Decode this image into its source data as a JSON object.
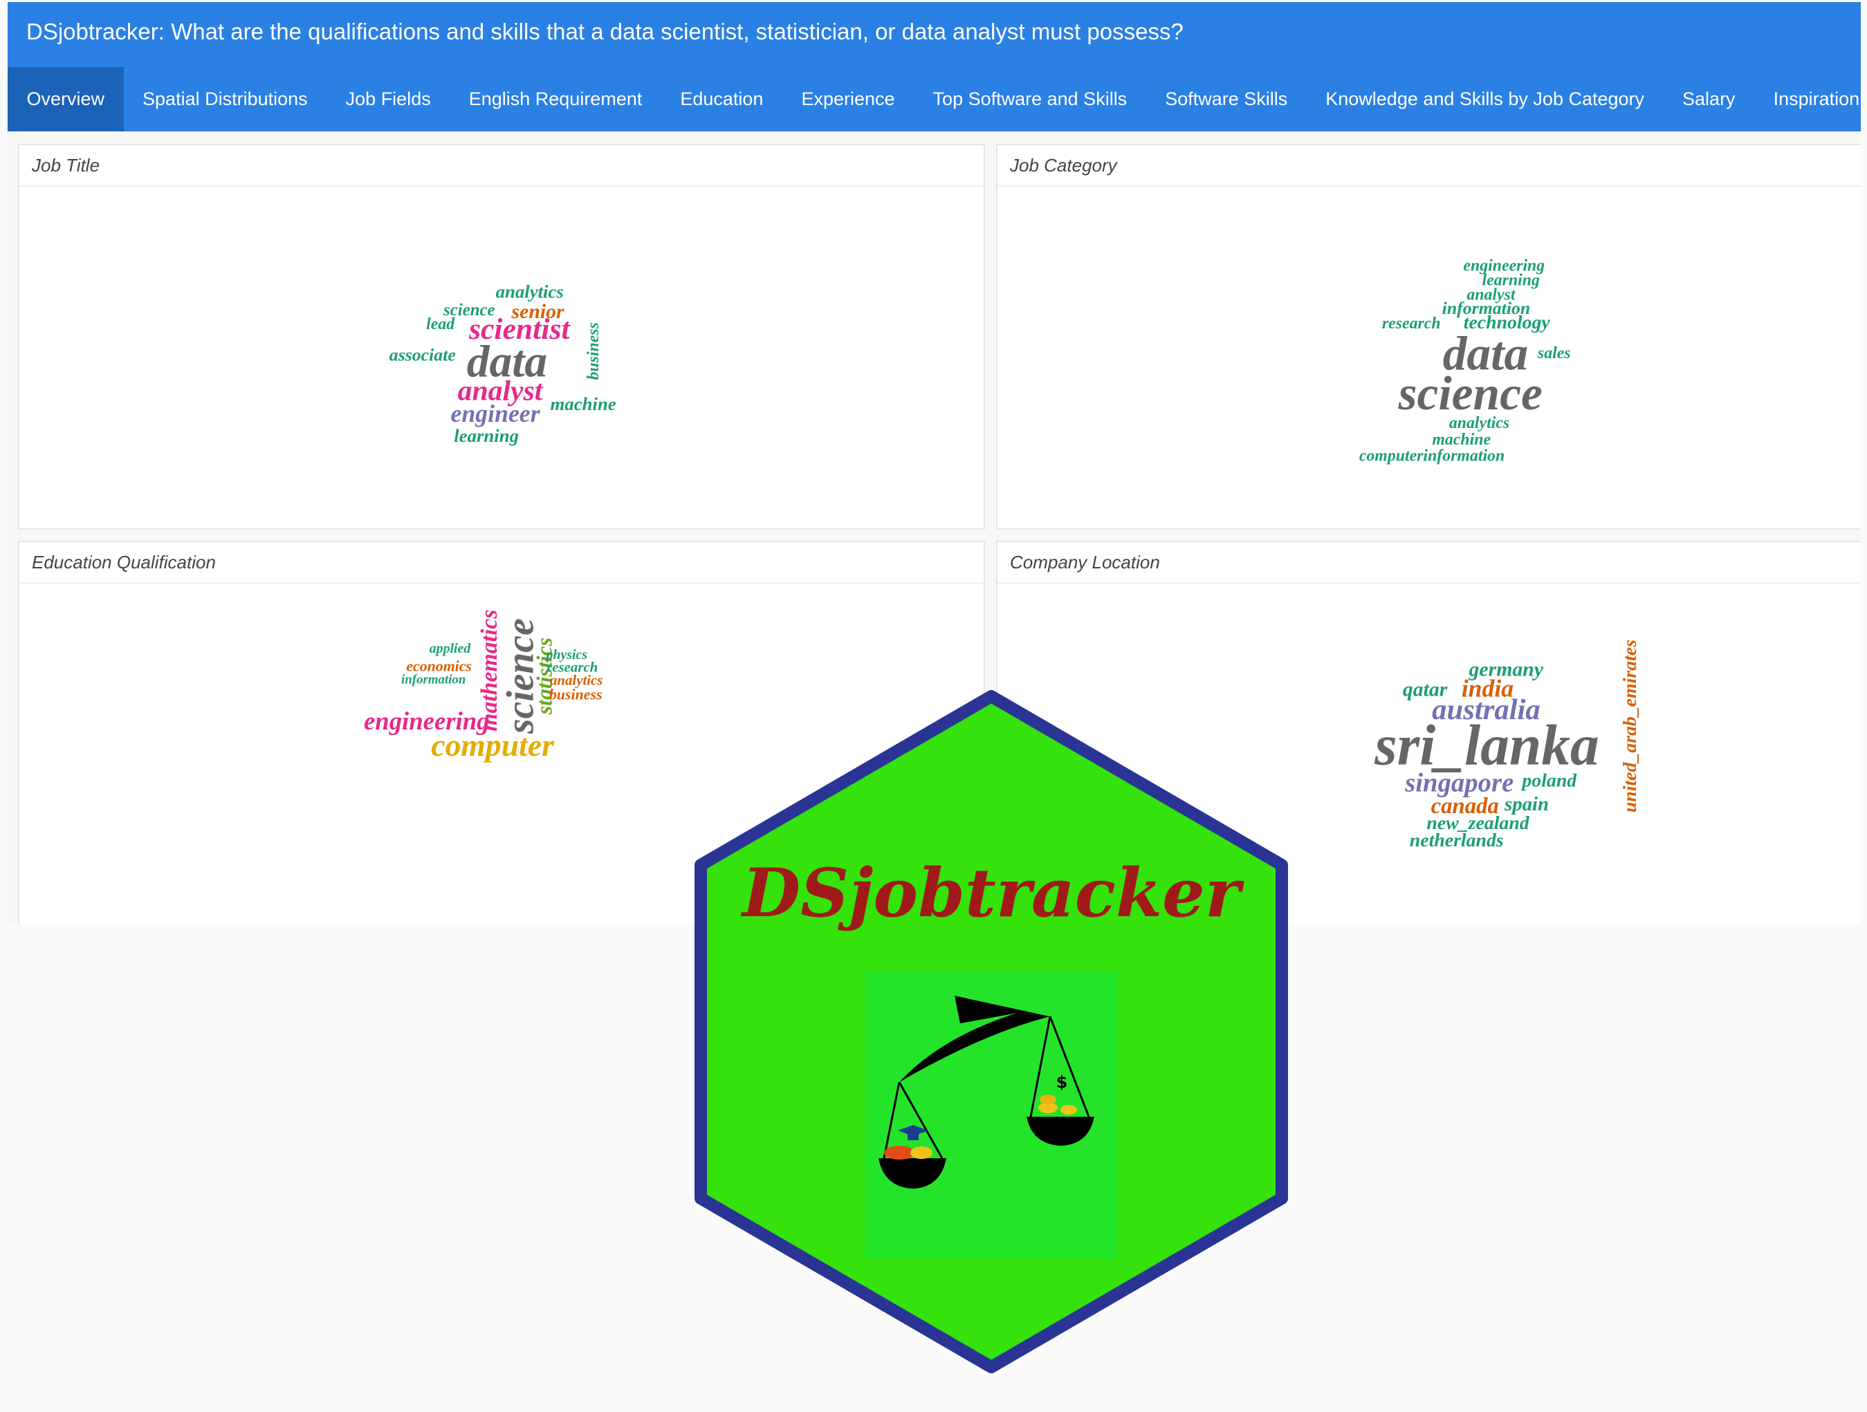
{
  "app": {
    "title": "DSjobtracker: What are the qualifications and skills that a data scientist, statistician, or data analyst must possess?"
  },
  "tabs": [
    {
      "label": "Overview",
      "active": true
    },
    {
      "label": "Spatial Distributions"
    },
    {
      "label": "Job Fields"
    },
    {
      "label": "English Requirement"
    },
    {
      "label": "Education"
    },
    {
      "label": "Experience"
    },
    {
      "label": "Top Software and Skills"
    },
    {
      "label": "Software Skills"
    },
    {
      "label": "Knowledge and Skills by Job Category"
    },
    {
      "label": "Salary"
    },
    {
      "label": "Inspiration"
    }
  ],
  "panels": {
    "job_title": {
      "header": "Job Title",
      "words": [
        "analytics",
        "science",
        "senior",
        "lead",
        "scientist",
        "associate",
        "data",
        "business",
        "analyst",
        "machine",
        "engineer",
        "learning"
      ]
    },
    "job_category": {
      "header": "Job Category",
      "words": [
        "engineering",
        "learning",
        "analyst",
        "information",
        "research",
        "technology",
        "data",
        "sales",
        "science",
        "analytics",
        "machine",
        "computerinformation"
      ]
    },
    "education": {
      "header": "Education Qualification",
      "words": [
        "mathematics",
        "science",
        "statistics",
        "applied",
        "economics",
        "information",
        "physics",
        "research",
        "analytics",
        "business",
        "engineering",
        "computer"
      ]
    },
    "location": {
      "header": "Company Location",
      "words": [
        "germany",
        "qatar",
        "india",
        "australia",
        "sri_lanka",
        "united_arab_emirates",
        "singapore",
        "poland",
        "canada",
        "spain",
        "new_zealand",
        "netherlands"
      ]
    }
  },
  "logo": {
    "title": "DSjobtracker",
    "scale_symbol": "$",
    "hex_fill": "#35e20c",
    "hex_border": "#2a3494",
    "title_color": "#a01a1a"
  },
  "colors": {
    "navbar": "#2a80e3",
    "active_tab": "#1b63b7",
    "word_teal": "#1b9e77",
    "word_orange": "#d95f02",
    "word_purple": "#7570b3",
    "word_pink": "#e7298a",
    "word_green": "#66a61e",
    "word_gold": "#e6ab02",
    "word_gray": "#666666"
  }
}
